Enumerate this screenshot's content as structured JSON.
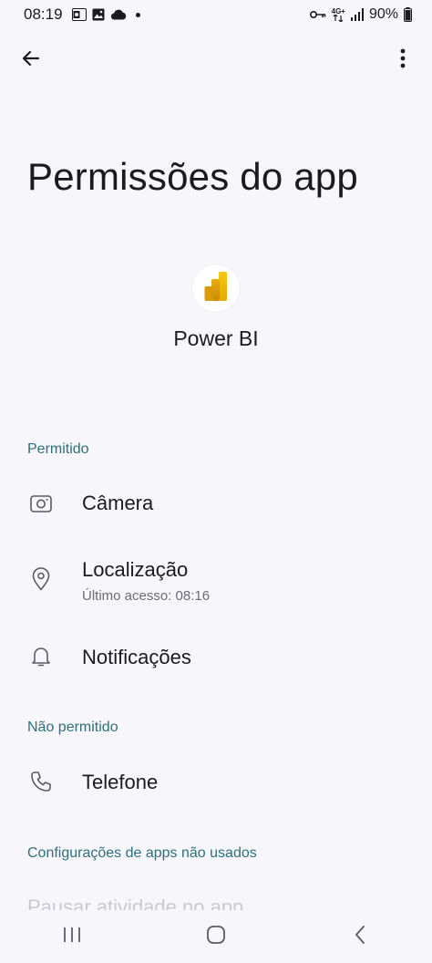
{
  "status_bar": {
    "time": "08:19",
    "battery_percent": "90%",
    "network_label": "4G+",
    "left_icons": [
      "outlook-icon",
      "gallery-icon",
      "cloud-icon",
      "dot-icon"
    ],
    "right_icons": [
      "key-icon",
      "network-icon",
      "signal-icon",
      "battery-icon"
    ]
  },
  "app_bar": {
    "back_icon": "arrow-left-icon",
    "more_icon": "more-vert-icon"
  },
  "page": {
    "title": "Permissões do app",
    "app_name": "Power BI",
    "app_icon": "power-bi-logo",
    "accent_color": "#2d6f7a"
  },
  "sections": {
    "allowed": {
      "header": "Permitido",
      "items": [
        {
          "label": "Câmera",
          "icon": "camera-icon"
        },
        {
          "label": "Localização",
          "subtitle": "Último acesso: 08:16",
          "icon": "location-icon"
        },
        {
          "label": "Notificações",
          "icon": "bell-icon"
        }
      ]
    },
    "not_allowed": {
      "header": "Não permitido",
      "items": [
        {
          "label": "Telefone",
          "icon": "phone-icon"
        }
      ]
    },
    "unused": {
      "header": "Configurações de apps não usados",
      "items": [
        {
          "label": "Pausar atividade no app"
        }
      ]
    }
  },
  "nav_bar": {
    "icons": [
      "recents-icon",
      "home-icon",
      "back-icon"
    ]
  }
}
